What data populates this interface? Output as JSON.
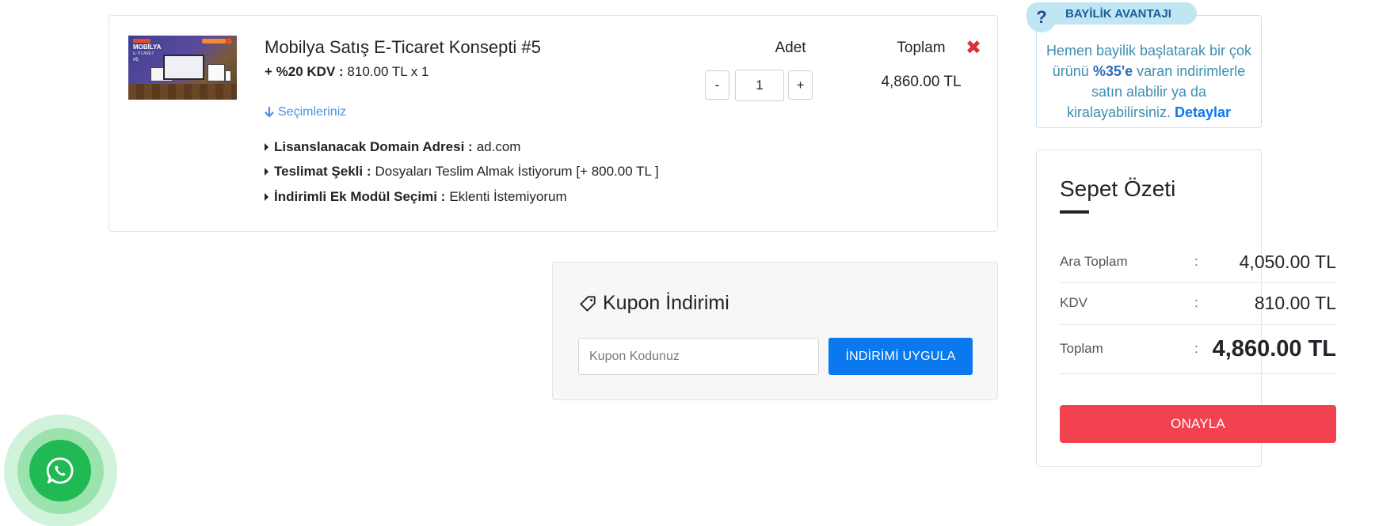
{
  "cart_item": {
    "title": "Mobilya Satış E-Ticaret Konsepti #5",
    "thumbnail": {
      "title": "MOBİLYA",
      "subtitle": "E-TİCARET",
      "number": "#5"
    },
    "price_label": "+ %20 KDV :",
    "price_value": "810.00 TL x 1",
    "selections_toggle": "Seçimleriniz",
    "options": [
      {
        "label": "Lisanslanacak Domain Adresi :",
        "value": "ad.com"
      },
      {
        "label": "Teslimat Şekli :",
        "value": "Dosyaları Teslim Almak İstiyorum [+ 800.00 TL ]"
      },
      {
        "label": "İndirimli Ek Modül Seçimi :",
        "value": "Eklenti İstemiyorum"
      }
    ],
    "quantity_header": "Adet",
    "quantity_minus": "-",
    "quantity_plus": "+",
    "quantity_value": "1",
    "total_header": "Toplam",
    "line_total": "4,860.00 TL",
    "remove_symbol": "✖"
  },
  "coupon": {
    "title": "Kupon İndirimi",
    "placeholder": "Kupon Kodunuz",
    "apply_button": "İNDİRİMİ UYGULA"
  },
  "advantage": {
    "icon_symbol": "?",
    "tab_label": "BAYİLİK AVANTAJI",
    "text_before": "Hemen bayilik başlatarak bir çok ürünü",
    "text_bold": "%35'e",
    "text_after": "varan indirimlerle satın alabilir ya da kiralayabilirsiniz.",
    "link_label": "Detaylar"
  },
  "summary": {
    "title": "Sepet Özeti",
    "separator": ":",
    "rows": [
      {
        "label": "Ara Toplam",
        "value": "4,050.00 TL"
      },
      {
        "label": "KDV",
        "value": "810.00 TL"
      },
      {
        "label": "Toplam",
        "value": "4,860.00 TL"
      }
    ],
    "confirm_button": "ONAYLA"
  },
  "colors": {
    "primary": "#0a79ee",
    "danger": "#f2414f",
    "whatsapp": "#20b954",
    "info_tab": "#bfe6f2"
  }
}
